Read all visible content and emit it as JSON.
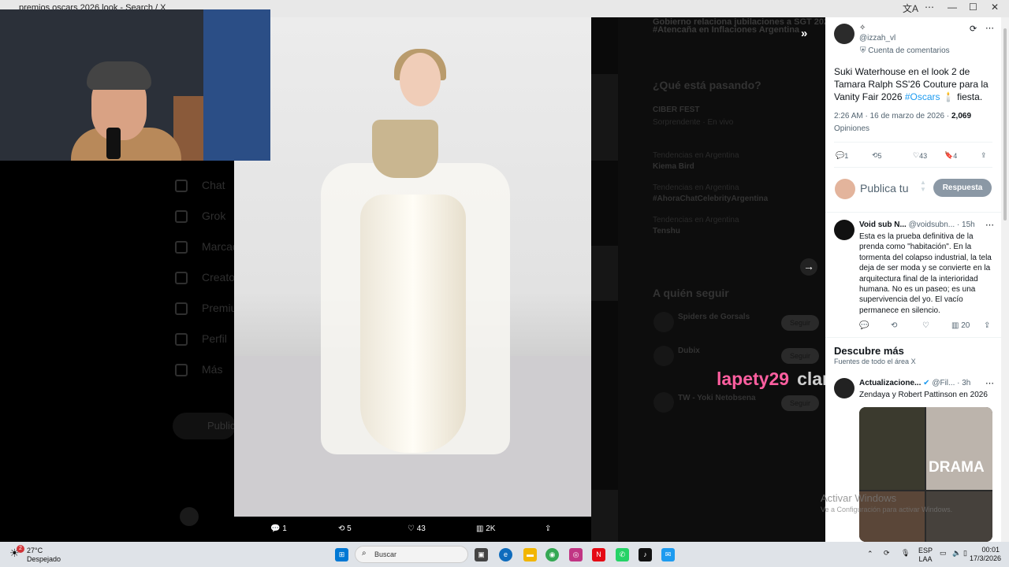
{
  "window": {
    "title": "premios oscars 2026 look - Search / X"
  },
  "background_nav": {
    "items": [
      "Chat",
      "Grok",
      "Marcadores",
      "Creator Studio",
      "Premium",
      "Perfil",
      "Más"
    ],
    "post_button": "Publicar"
  },
  "background_right": {
    "top_lines": [
      "Gobierno relaciona jubilaciones a SGT 2026",
      "#Atencaña en Inflaciones Argentina"
    ],
    "trends_heading": "¿Qué está pasando?",
    "trends": [
      {
        "title": "CIBER FEST",
        "context": "Sorprendente · En vivo"
      },
      {
        "title": "Kiema Bird",
        "context": "Tendencias en Argentina"
      },
      {
        "title": "#AhoraChatCelebrityArgentina",
        "context": "Tendencias en Argentina"
      },
      {
        "title": "Tenshu",
        "context": "Tendencias en Argentina"
      }
    ],
    "follow_heading": "A quién seguir",
    "follow": [
      {
        "name": "Spiders de Gorsals",
        "button": "Seguir"
      },
      {
        "name": "Dubix",
        "button": "Seguir"
      },
      {
        "name": "TW - Yoki Netobsena",
        "button": "Seguir"
      }
    ]
  },
  "photo_bar": {
    "replies": "1",
    "reposts": "5",
    "likes": "43",
    "views": "2K"
  },
  "overlay": {
    "watermark_user": "lapety29",
    "watermark_tail": "claro"
  },
  "tweet": {
    "display_name": "✧",
    "handle": "@izzah_vl",
    "account_label": "Cuenta de comentarios",
    "text_before": "Suki Waterhouse en el look 2 de Tamara Ralph SS'26 Couture para la Vanity Fair 2026 ",
    "hashtag": "#Oscars",
    "text_after": "🕯️ fiesta.",
    "time": "2:26 AM · 16 de marzo de 2026 · ",
    "views": "2,069",
    "views_label": "Opiniones",
    "replies": "1",
    "reposts": "5",
    "likes": "43",
    "bookmarks": "4"
  },
  "reply_box": {
    "placeholder": "Publica tu",
    "button": "Respuesta"
  },
  "reply": {
    "name": "Void sub N...",
    "handle": "@voidsubn...",
    "time": "· 15h",
    "text": "Esta es la prueba definitiva de la prenda como \"habitación\". En la tormenta del colapso industrial, la tela deja de ser moda y se convierte en la arquitectura final de la interioridad humana. No es un paseo; es una supervivencia del yo. El vacío permanece en silencio.",
    "views": "20"
  },
  "discover": {
    "title": "Descubre más",
    "subtitle": "Fuentes de todo el área X",
    "post_name": "Actualizacione...",
    "post_handle": "@Fil...",
    "post_time": "· 3h",
    "post_text": "Zendaya y Robert Pattinson en 2026",
    "poster_title": "DRAMA"
  },
  "activation": {
    "line1": "Activar Windows",
    "line2": "Ve a Configuración para activar Windows."
  },
  "taskbar": {
    "weather_temp": "27°C",
    "weather_desc": "Despejado",
    "weather_badge": "2",
    "search_placeholder": "Buscar",
    "lang": "ESP",
    "layout": "LAA",
    "time": "00:01",
    "date": "17/3/2026"
  },
  "colors": {
    "accent": "#1d9bf0",
    "watermark_pink": "#ff5fa0",
    "reply_button": "#8b98a5"
  }
}
